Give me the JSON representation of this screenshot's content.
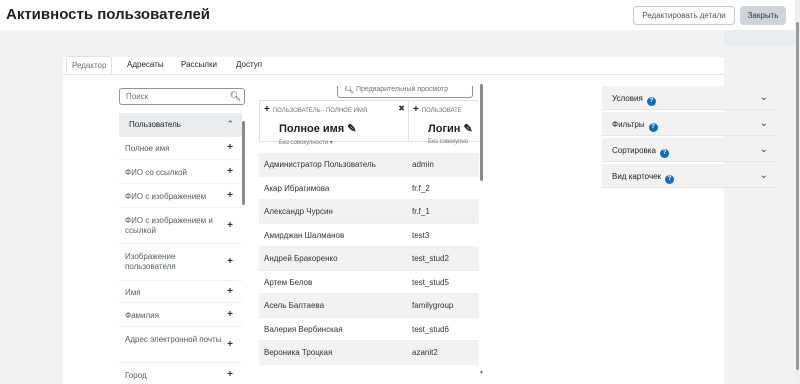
{
  "header": {
    "title": "Активность пользователей",
    "edit_details_label": "Редактировать детали",
    "close_label": "Закрыть"
  },
  "tabs": [
    {
      "label": "Редактор",
      "active": true
    },
    {
      "label": "Адресаты",
      "active": false
    },
    {
      "label": "Рассылки",
      "active": false
    },
    {
      "label": "Доступ",
      "active": false
    }
  ],
  "sidebar": {
    "search_placeholder": "Поиск",
    "group_label": "Пользователь",
    "fields": [
      {
        "label": "Полное имя"
      },
      {
        "label": "ФИО со ссылкой"
      },
      {
        "label": "ФИО с изображением"
      },
      {
        "label": "ФИО с изображением и ссылкой"
      },
      {
        "label": "Изображение пользователя"
      },
      {
        "label": "Имя"
      },
      {
        "label": "Фамилия"
      },
      {
        "label": "Адрес электронной почты"
      },
      {
        "label": "Город"
      }
    ]
  },
  "table": {
    "preview_placeholder": "Предварительный просмотр",
    "columns": [
      {
        "source": "ПОЛЬЗОВАТЕЛЬ - ПОЛНОЕ ИМЯ",
        "name": "Полное имя",
        "aggregation": "Без совокупности"
      },
      {
        "source": "ПОЛЬЗОВАТЕ",
        "name": "Логин",
        "aggregation": "Без совокупно"
      }
    ],
    "rows": [
      {
        "full_name": "Администратор Пользователь",
        "login": "admin"
      },
      {
        "full_name": "Акар Ибрагимова",
        "login": "fr.f_2"
      },
      {
        "full_name": "Александр Чурсин",
        "login": "fr.f_1"
      },
      {
        "full_name": "Амирджан Шалманов",
        "login": "test3"
      },
      {
        "full_name": "Андрей Бракоренко",
        "login": "test_stud2"
      },
      {
        "full_name": "Артем Белов",
        "login": "test_stud5"
      },
      {
        "full_name": "Асель Балтаева",
        "login": "familygroup"
      },
      {
        "full_name": "Валерия Вербинская",
        "login": "test_stud6"
      },
      {
        "full_name": "Вероника Троцкая",
        "login": "azanit2"
      }
    ]
  },
  "settings": [
    {
      "label": "Условия"
    },
    {
      "label": "Фильтры"
    },
    {
      "label": "Сортировка"
    },
    {
      "label": "Вид карточек"
    }
  ],
  "icons": {
    "search": "search-icon",
    "plus": "plus-icon",
    "chevron": "chevron-icon",
    "pencil": "pencil-icon",
    "help": "help-icon",
    "remove": "close-icon"
  },
  "colors": {
    "accent": "#0f6cbf",
    "close_button_bg": "#ced4da"
  }
}
